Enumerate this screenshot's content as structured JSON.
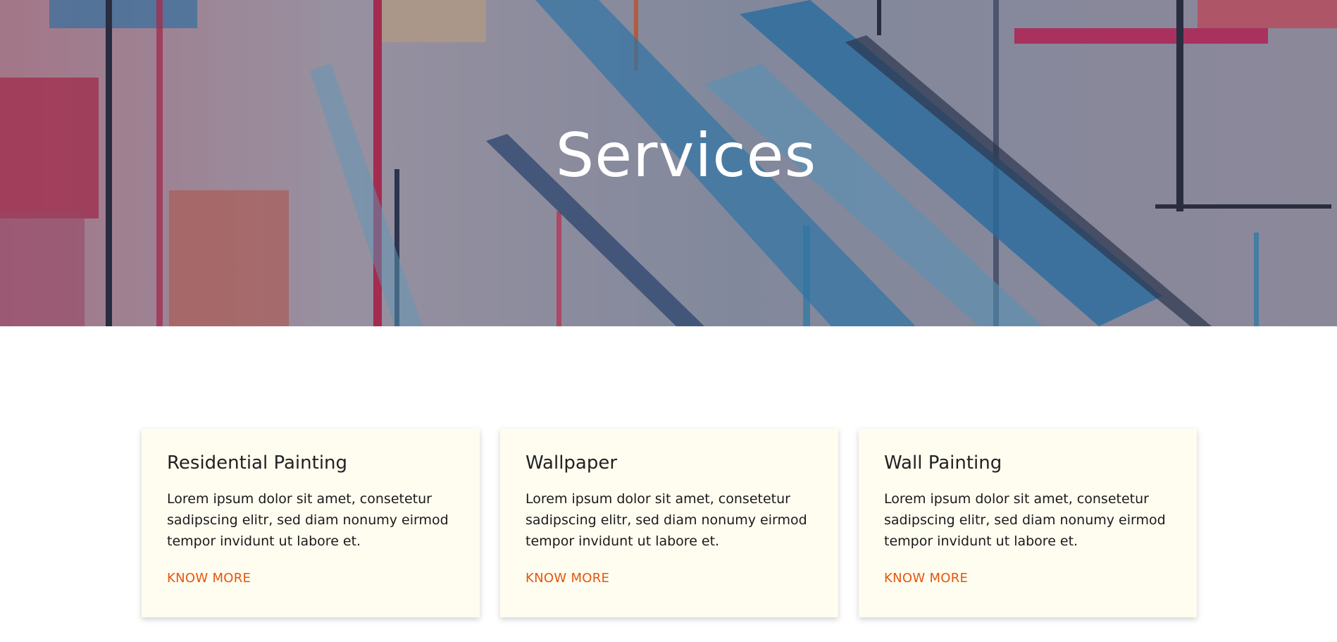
{
  "hero": {
    "title": "Services"
  },
  "services": [
    {
      "title": "Residential Painting",
      "description": "Lorem ipsum dolor sit amet, consetetur sadipscing elitr, sed diam nonumy eirmod tempor invidunt ut labore et.",
      "link_label": "KNOW MORE"
    },
    {
      "title": "Wallpaper",
      "description": "Lorem ipsum dolor sit amet, consetetur sadipscing elitr, sed diam nonumy eirmod tempor invidunt ut labore et.",
      "link_label": "KNOW MORE"
    },
    {
      "title": "Wall Painting",
      "description": "Lorem ipsum dolor sit amet, consetetur sadipscing elitr, sed diam nonumy eirmod tempor invidunt ut labore et.",
      "link_label": "KNOW MORE"
    }
  ],
  "colors": {
    "accent": "#e5560b",
    "card_background": "#fffcf0"
  }
}
